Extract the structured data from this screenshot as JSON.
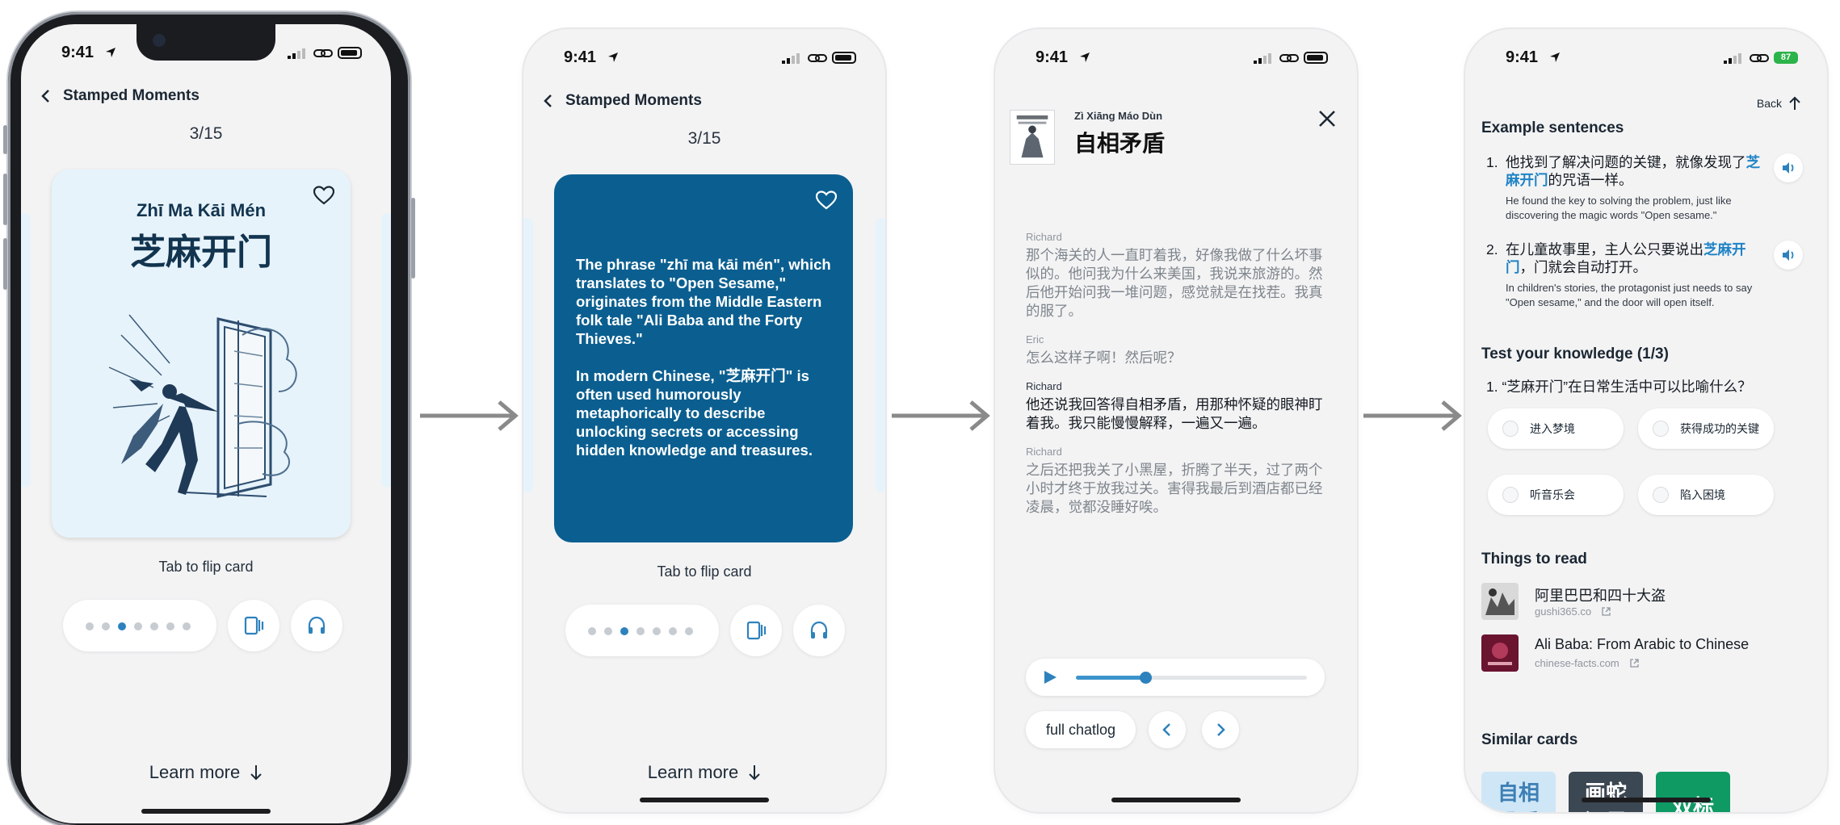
{
  "status": {
    "time": "9:41",
    "battery_last": "87"
  },
  "phone1": {
    "nav_title": "Stamped Moments",
    "counter": "3/15",
    "card_pinyin": "Zhī Ma Kāi Mén",
    "card_hanzi": "芝麻开门",
    "flip_hint": "Tab to flip card",
    "learn_more": "Learn more"
  },
  "phone2": {
    "nav_title": "Stamped Moments",
    "counter": "3/15",
    "back_para1": "The phrase \"zhī ma kāi mén\", which translates to \"Open Sesame,\" originates from the Middle Eastern folk tale \"Ali Baba and the Forty Thieves.\"",
    "back_para2_pre": "In modern Chinese, \"",
    "back_para2_hl": "芝麻开门",
    "back_para2_post": "\" is often used humorously metaphorically to describe unlocking secrets or accessing hidden knowledge and treasures.",
    "flip_hint": "Tab to flip card",
    "learn_more": "Learn more"
  },
  "phone3": {
    "pinyin": "Zì Xiāng Máo Dùn",
    "title": "自相矛盾",
    "messages": [
      {
        "speaker": "Richard",
        "text": "那个海关的人一直盯着我，好像我做了什么坏事似的。他问我为什么来美国，我说来旅游的。然后他开始问我一堆问题，感觉就是在找茬。我真的服了。"
      },
      {
        "speaker": "Eric",
        "text": "怎么这样子啊！然后呢？"
      },
      {
        "speaker": "Richard",
        "text": "他还说我回答得自相矛盾，用那种怀疑的眼神盯着我。我只能慢慢解释，一遍又一遍。"
      },
      {
        "speaker": "Richard",
        "text": "之后还把我关了小黑屋，折腾了半天，过了两个小时才终于放我过关。害得我最后到酒店都已经凌晨，觉都没睡好唉。"
      }
    ],
    "audio_progress": 0.3,
    "full_chatlog": "full chatlog"
  },
  "phone4": {
    "back_label": "Back",
    "examples_heading": "Example sentences",
    "examples": [
      {
        "num": "1.",
        "pre": "他找到了解决问题的关键，就像发现了",
        "hl": "芝麻开门",
        "post": "的咒语一样。",
        "en": "He found the key to solving the problem, just like discovering the magic words \"Open sesame.\""
      },
      {
        "num": "2.",
        "pre": "在儿童故事里，主人公只要说出",
        "hl": "芝麻开门",
        "post": "，门就会自动打开。",
        "en": "In children's stories, the protagonist just needs to say \"Open sesame,\" and the door will open itself."
      }
    ],
    "quiz_heading": "Test your knowledge (1/3)",
    "quiz_question": "1. “芝麻开门”在日常生活中可以比喻什么？",
    "options": [
      "进入梦境",
      "获得成功的关键",
      "听音乐会",
      "陷入困境"
    ],
    "read_heading": "Things to read",
    "reads": [
      {
        "title": "阿里巴巴和四十大盗",
        "source": "gushi365.co"
      },
      {
        "title": "Ali Baba: From Arabic to Chinese",
        "source": "chinese-facts.com"
      }
    ],
    "similar_heading": "Similar cards",
    "similar": [
      "自相矛盾",
      "画蛇添足",
      "双标"
    ],
    "colors": {
      "accent": "#1f83c5",
      "similar1": "#cfe6f6",
      "similar2": "#3b4752",
      "similar3": "#0f9a64"
    }
  }
}
